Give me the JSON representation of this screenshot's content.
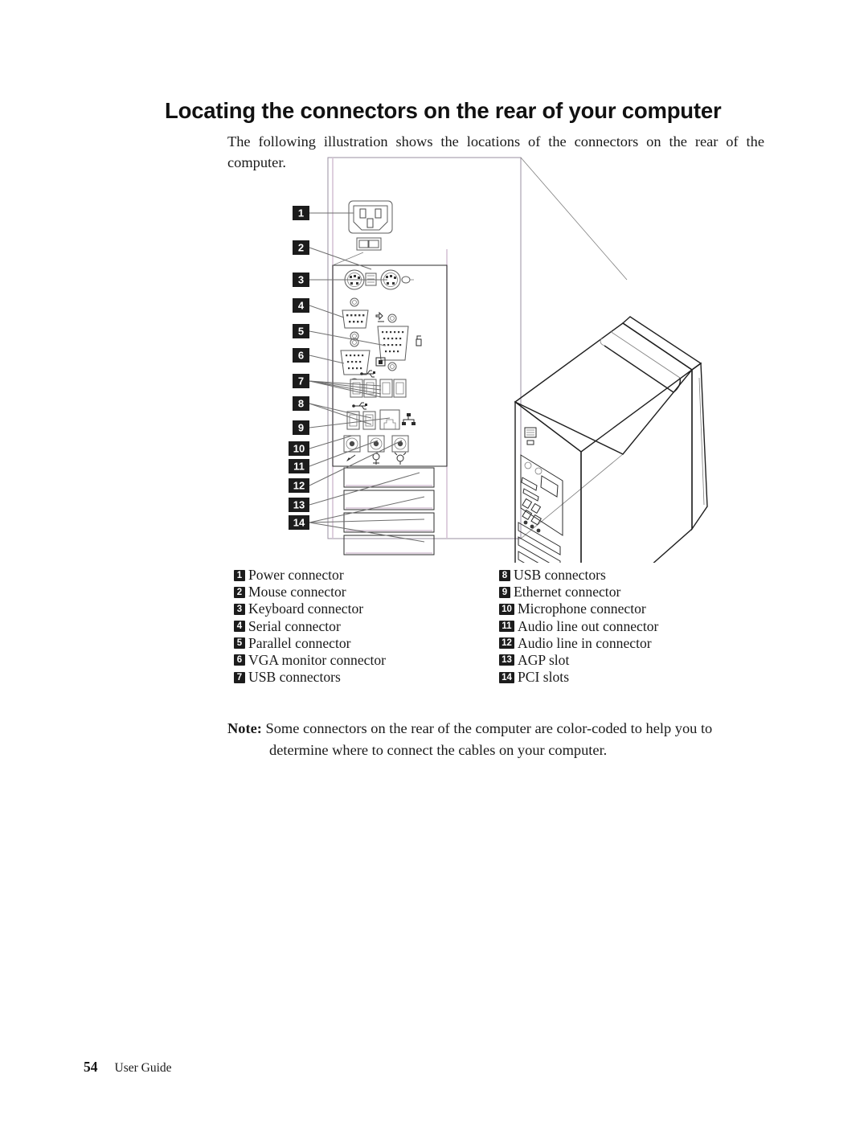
{
  "document": {
    "title": "Locating the connectors on the rear of your computer",
    "intro": "The following illustration shows the locations of the connectors on the rear of the computer.",
    "note": {
      "label": "Note:",
      "line1": "Some connectors on the rear of the computer are color-coded to help you to",
      "line2": "determine where to connect the cables on your computer."
    },
    "footer": {
      "page_number": "54",
      "guide_label": "User Guide"
    }
  },
  "figure": {
    "callouts": [
      "1",
      "2",
      "3",
      "4",
      "5",
      "6",
      "7",
      "8",
      "9",
      "10",
      "11",
      "12",
      "13",
      "14"
    ],
    "panel_label": "rear connector panel detail",
    "chassis_label": "isometric tower computer rear view"
  },
  "legend": {
    "left": [
      {
        "num": "1",
        "label": "Power connector"
      },
      {
        "num": "2",
        "label": "Mouse connector"
      },
      {
        "num": "3",
        "label": "Keyboard connector"
      },
      {
        "num": "4",
        "label": "Serial connector"
      },
      {
        "num": "5",
        "label": "Parallel connector"
      },
      {
        "num": "6",
        "label": "VGA monitor connector"
      },
      {
        "num": "7",
        "label": "USB connectors"
      }
    ],
    "right": [
      {
        "num": "8",
        "label": "USB connectors"
      },
      {
        "num": "9",
        "label": "Ethernet connector"
      },
      {
        "num": "10",
        "label": "Microphone connector"
      },
      {
        "num": "11",
        "label": "Audio line out connector"
      },
      {
        "num": "12",
        "label": "Audio line in connector"
      },
      {
        "num": "13",
        "label": "AGP slot"
      },
      {
        "num": "14",
        "label": "PCI slots"
      }
    ]
  },
  "colors": {
    "text": "#1a1a1a",
    "badge_bg": "#1c1c1c",
    "badge_fg": "#ffffff",
    "line_gray": "#6e6e6e",
    "detail_box": "#8a8a8a",
    "accent_lavender": "#d8c6d8"
  }
}
